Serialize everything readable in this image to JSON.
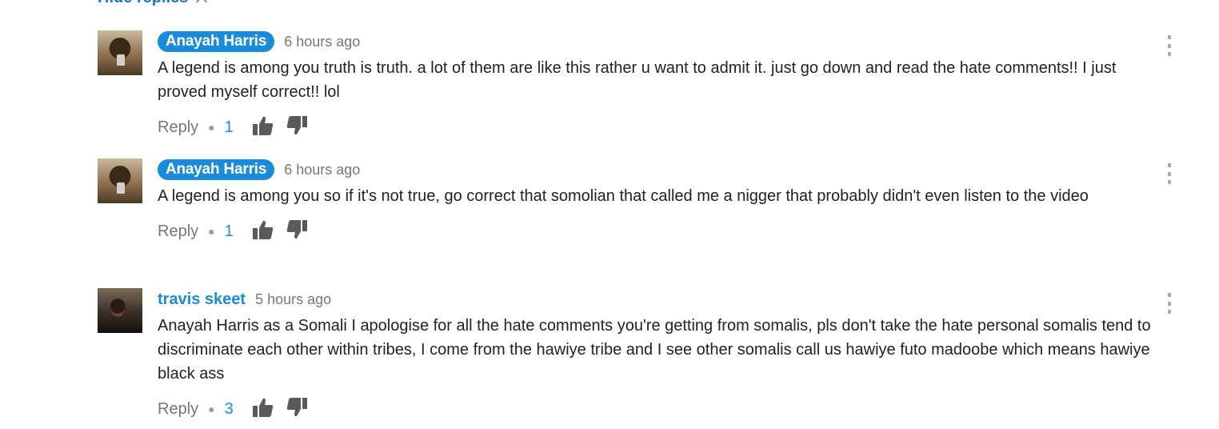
{
  "hide_replies": {
    "label": "Hide replies",
    "chevron_icon": "chevron-up-icon"
  },
  "colors": {
    "link": "#1a8bd8",
    "muted": "#767676",
    "text": "#222222",
    "icon": "#5a5a5a"
  },
  "comments": [
    {
      "author": "Anayah Harris",
      "time": "6 hours ago",
      "text": "A legend is among you truth is truth. a lot of them are like this rather u want to admit it. just go down and read the hate comments!! I just proved myself correct!! lol",
      "reply_label": "Reply",
      "likes": "1",
      "highlighted": true
    },
    {
      "author": "Anayah Harris",
      "time": "6 hours ago",
      "text": "A legend is among you so if it's not true, go correct that somolian that called me a nigger that probably didn't even listen to the video",
      "reply_label": "Reply",
      "likes": "1",
      "highlighted": true
    },
    {
      "author": "travis skeet",
      "time": "5 hours ago",
      "text": "Anayah Harris as a Somali I apologise for all the hate comments you're getting from somalis, pls don't take the hate personal somalis tend to discriminate each other within tribes, I come from the hawiye tribe and I see other somalis call us hawiye futo madoobe which means hawiye black ass",
      "reply_label": "Reply",
      "likes": "3",
      "highlighted": false
    }
  ]
}
